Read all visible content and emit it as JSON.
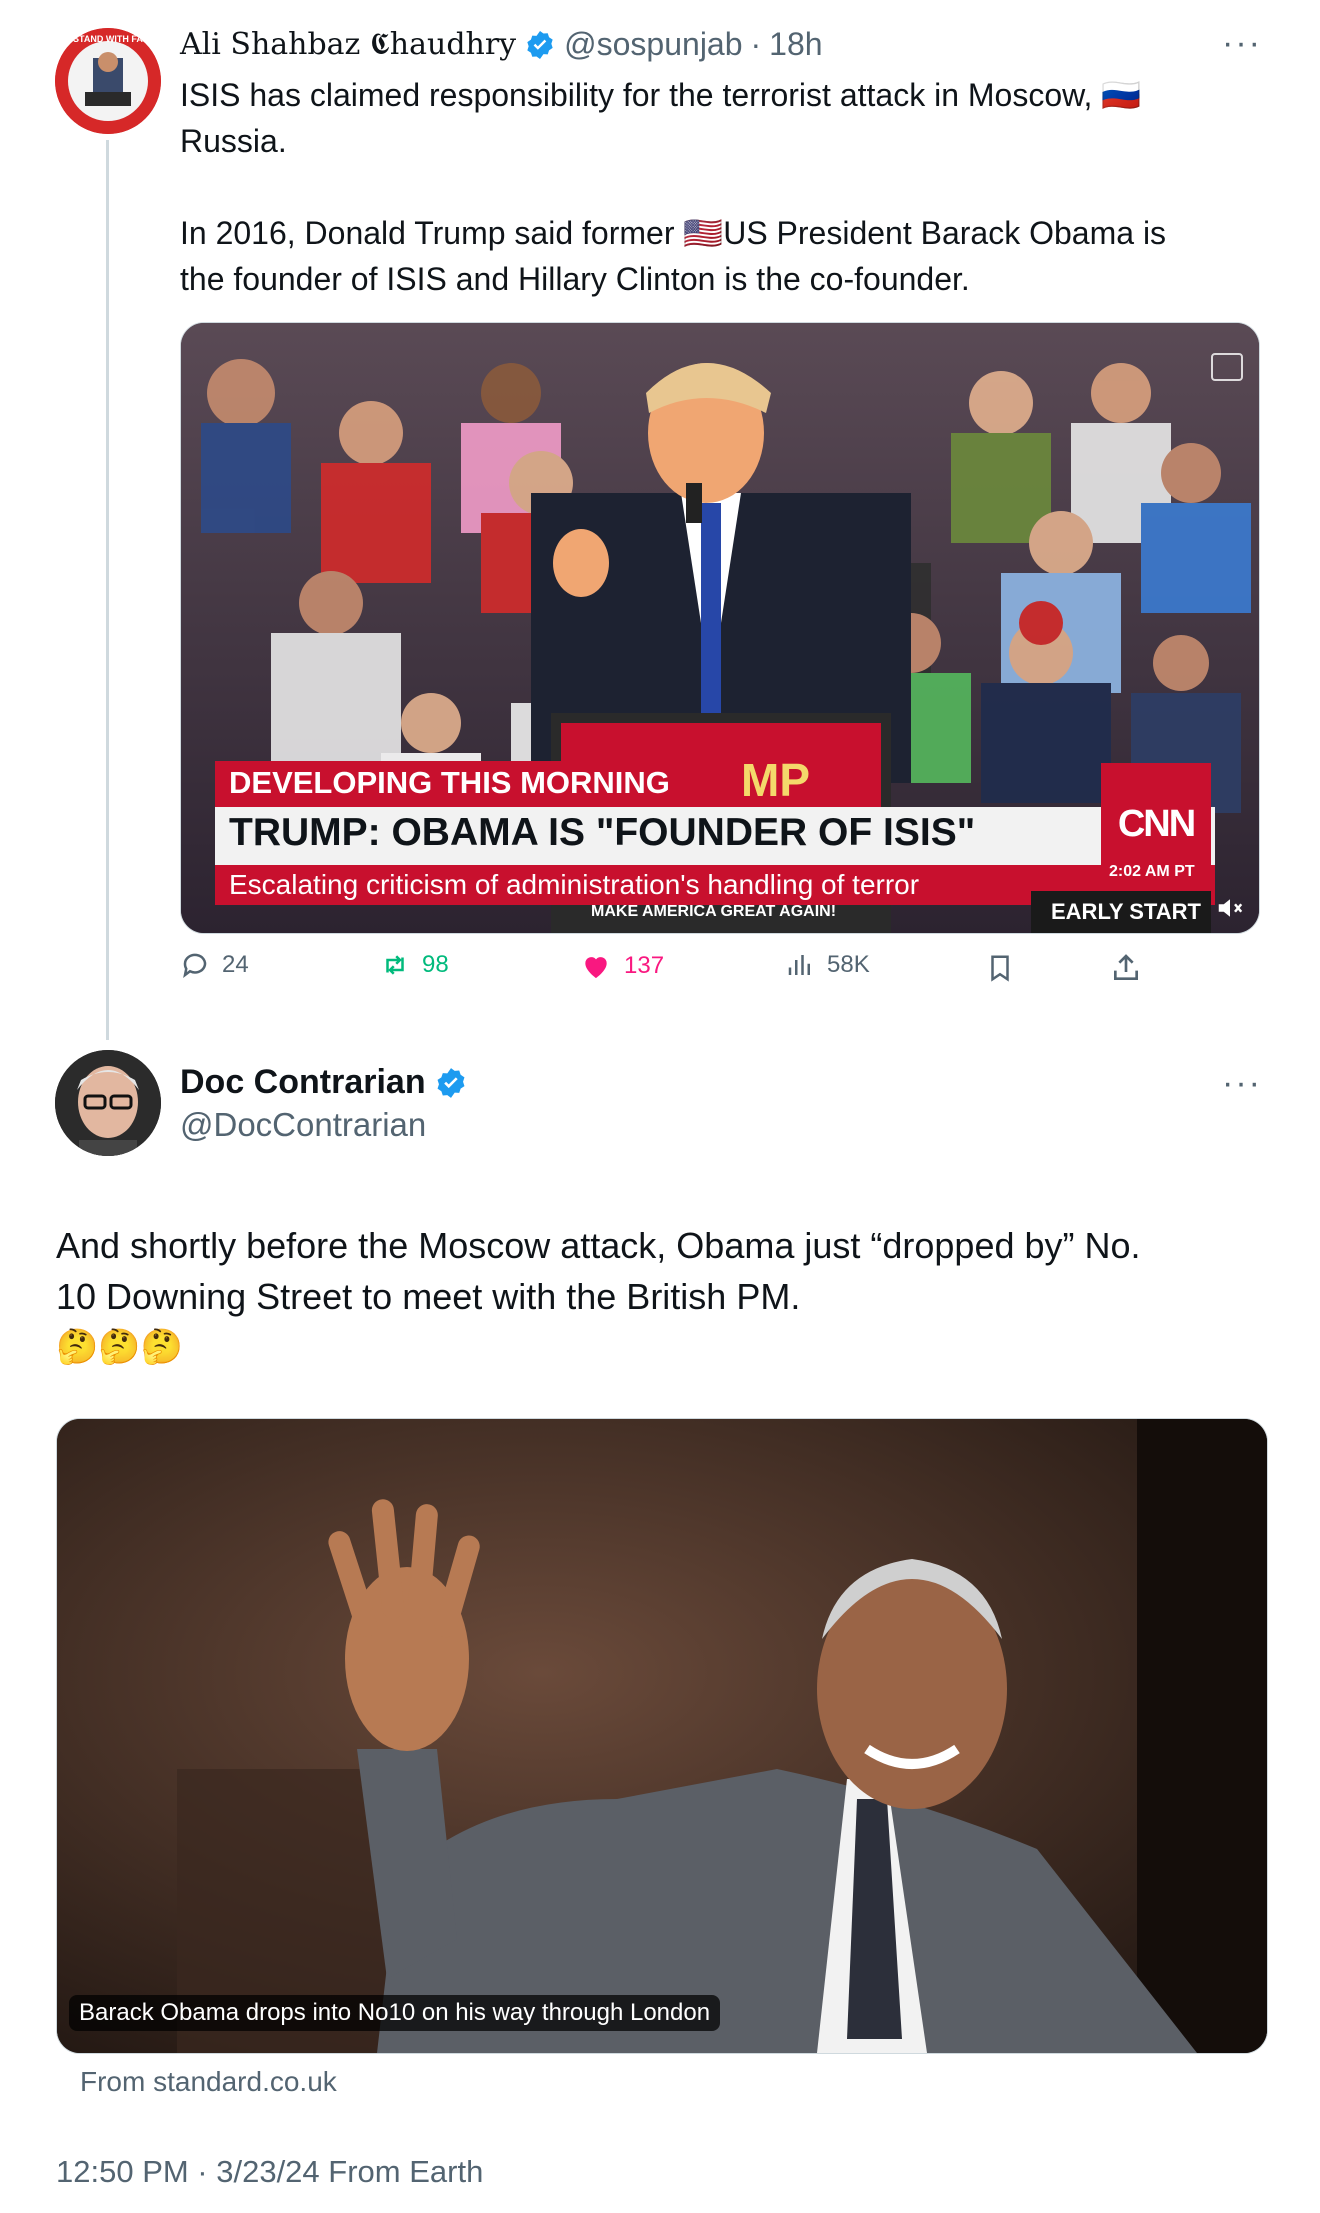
{
  "tweet1": {
    "author_name": "Ali Shahbaz 𝕮haudhry",
    "handle": "@sospunjab",
    "separator": "·",
    "time": "18h",
    "more": "···",
    "avatar_text": "STAND WITH FARMER",
    "text_line1": "ISIS has claimed responsibility for the terrorist attack in Moscow, 🇷🇺",
    "text_line2": "Russia.",
    "text_line3": "In 2016, Donald Trump said former 🇺🇸US President Barack Obama is",
    "text_line4": "the founder of ISIS and Hillary Clinton is the co-founder.",
    "video": {
      "top_red": "DEVELOPING THIS MORNING",
      "headline": "TRUMP: OBAMA IS \"FOUNDER OF ISIS\"",
      "subline": "Escalating criticism of administration's handling of terror",
      "podium_text": "MAKE AMERICA GREAT AGAIN!",
      "podium_letters": "MP",
      "network": "CNN",
      "clock": "2:02 AM PT",
      "show": "EARLY START"
    },
    "actions": {
      "replies": "24",
      "retweets": "98",
      "likes": "137",
      "views": "58K"
    },
    "colors": {
      "retweet": "#00ba7c",
      "like": "#f91880",
      "verified": "#1d9bf0"
    }
  },
  "tweet2": {
    "author_name": "Doc Contrarian",
    "handle": "@DocContrarian",
    "more": "···",
    "text_line1": "And shortly before the Moscow attack, Obama just “dropped by” No.",
    "text_line2": "10 Downing Street to meet with the British PM.",
    "text_line3": "🤔🤔🤔",
    "card": {
      "caption": "Barack Obama drops into No10 on his way through London",
      "source": "From standard.co.uk"
    },
    "timestamp": "12:50 PM · 3/23/24 From Earth"
  }
}
